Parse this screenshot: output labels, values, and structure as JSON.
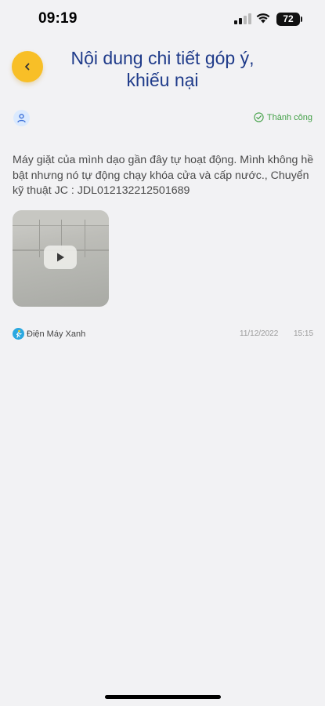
{
  "status_bar": {
    "time": "09:19",
    "battery": "72"
  },
  "header": {
    "back_icon": "chevron-left-icon",
    "title": "Nội dung chi tiết góp ý, khiếu nại"
  },
  "meta": {
    "avatar_icon": "user-icon",
    "status_icon": "check-circle-icon",
    "status_label": "Thành công",
    "status_color": "#43a047"
  },
  "message": {
    "text": "Máy giặt của mình dạo gần đây tự hoạt động. Mình không hề bật nhưng nó tự động chạy khóa cửa và cấp nước., Chuyển kỹ thuật JC : JDL012132212501689"
  },
  "attachment": {
    "type": "video",
    "play_icon": "play-icon"
  },
  "footer": {
    "source_icon": "dmx-logo-icon",
    "source_name": "Điện Máy Xanh",
    "date": "11/12/2022",
    "time": "15:15"
  },
  "colors": {
    "accent": "#f8bf27",
    "title": "#1f3b8a",
    "background": "#f2f2f4"
  }
}
